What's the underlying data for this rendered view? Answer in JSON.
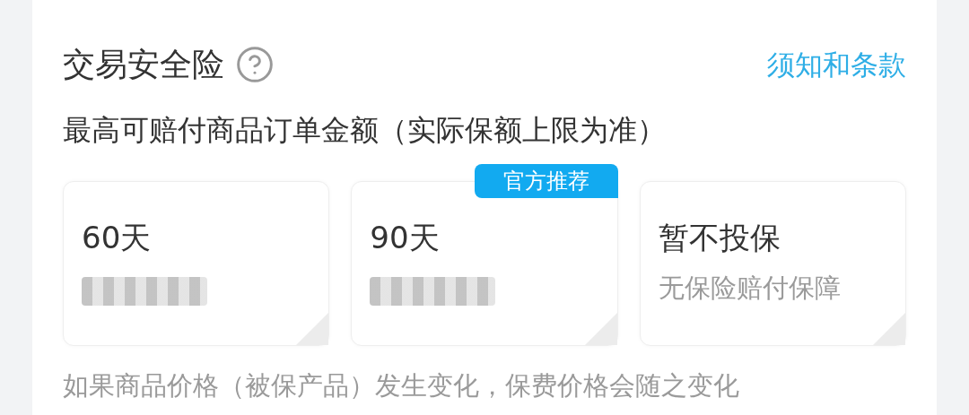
{
  "section": {
    "title": "交易安全险",
    "terms_link": "须知和条款"
  },
  "subtitle": "最高可赔付商品订单金额（实际保额上限为准）",
  "options": [
    {
      "period": "60天",
      "kind": "priced"
    },
    {
      "period": "90天",
      "kind": "priced",
      "badge": "官方推荐"
    },
    {
      "period": "暂不投保",
      "kind": "none",
      "note": "无保险赔付保障"
    }
  ],
  "footnote": "如果商品价格（被保产品）发生变化，保费价格会随之变化"
}
